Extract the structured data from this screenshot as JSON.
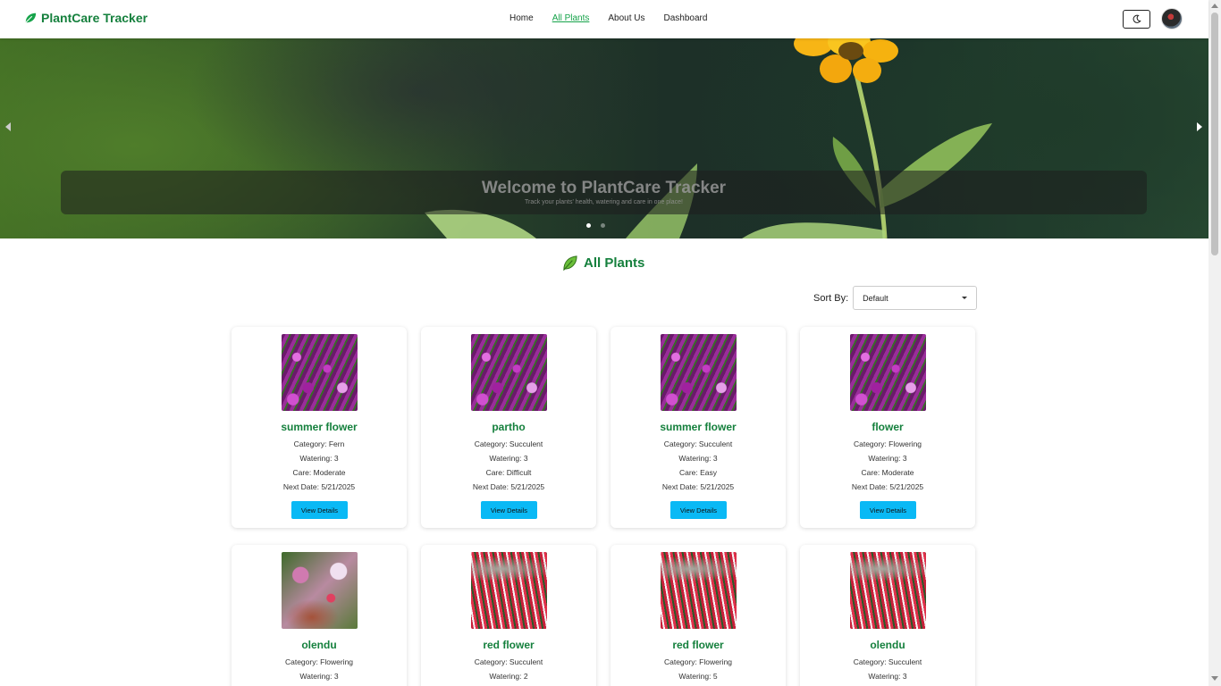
{
  "navbar": {
    "brand": "PlantCare Tracker",
    "links": [
      {
        "label": "Home",
        "active": false
      },
      {
        "label": "All Plants",
        "active": true
      },
      {
        "label": "About Us",
        "active": false
      },
      {
        "label": "Dashboard",
        "active": false
      }
    ],
    "theme_toggle_icon": "moon-icon",
    "avatar_icon": "user-avatar"
  },
  "hero": {
    "title": "Welcome to PlantCare Tracker",
    "subtitle": "Track your plants' health, watering and care in one place!",
    "slide_count": 2,
    "active_slide": 0
  },
  "section": {
    "title": "All Plants",
    "icon": "leaf-icon"
  },
  "sort": {
    "label": "Sort By:",
    "selected": "Default"
  },
  "plants": [
    {
      "name": "summer flower",
      "category": "Category: Fern",
      "watering": "Watering: 3",
      "care": "Care: Moderate",
      "next": "Next Date: 5/21/2025",
      "button": "View Details",
      "image": "purple-flowers"
    },
    {
      "name": "partho",
      "category": "Category: Succulent",
      "watering": "Watering: 3",
      "care": "Care: Difficult",
      "next": "Next Date: 5/21/2025",
      "button": "View Details",
      "image": "purple-flowers"
    },
    {
      "name": "summer flower",
      "category": "Category: Succulent",
      "watering": "Watering: 3",
      "care": "Care: Easy",
      "next": "Next Date: 5/21/2025",
      "button": "View Details",
      "image": "purple-flowers"
    },
    {
      "name": "flower",
      "category": "Category: Flowering",
      "watering": "Watering: 3",
      "care": "Care: Moderate",
      "next": "Next Date: 5/21/2025",
      "button": "View Details",
      "image": "purple-flowers"
    },
    {
      "name": "olendu",
      "category": "Category: Flowering",
      "watering": "Watering: 3",
      "image": "garden-path"
    },
    {
      "name": "red flower",
      "category": "Category: Succulent",
      "watering": "Watering: 2",
      "image": "red-tulips"
    },
    {
      "name": "red flower",
      "category": "Category: Flowering",
      "watering": "Watering: 5",
      "image": "red-tulips"
    },
    {
      "name": "olendu",
      "category": "Category: Succulent",
      "watering": "Watering: 3",
      "image": "red-tulips"
    }
  ]
}
